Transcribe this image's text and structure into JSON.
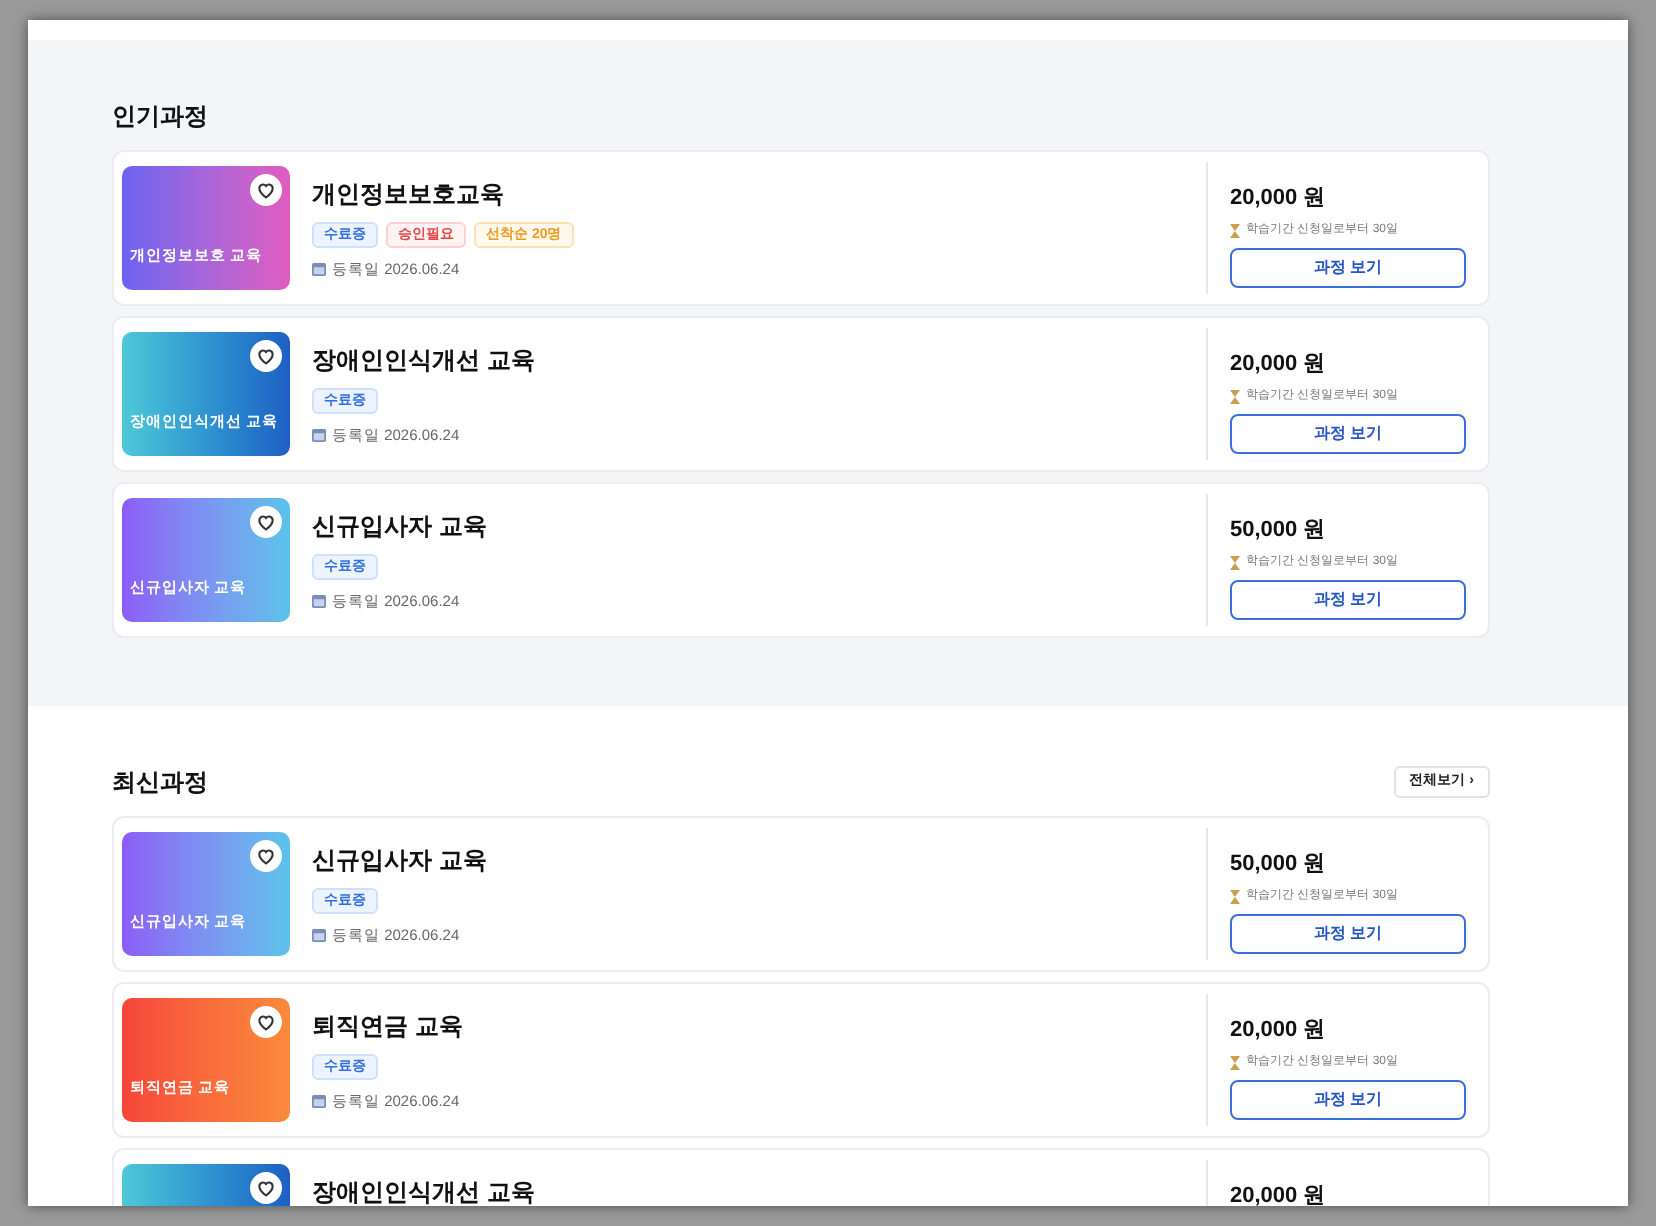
{
  "sections": [
    {
      "title": "인기과정",
      "courses": [
        {
          "thumb_label": "개인정보보호 교육",
          "kind": "purple",
          "title": "개인정보보호교육",
          "tags": [
            {
              "label": "수료증",
              "kind": "status"
            },
            {
              "label": "승인필요",
              "kind": "approval"
            },
            {
              "label": "선착순 20명",
              "kind": "limit"
            }
          ],
          "date": "등록일 2026.06.24",
          "price": "20,000 원",
          "period": "학습기간 신청일로부터 30일",
          "button": "과정 보기"
        },
        {
          "thumb_label": "장애인인식개선 교육",
          "kind": "cyan",
          "title": "장애인인식개선 교육",
          "tags": [
            {
              "label": "수료증",
              "kind": "status"
            }
          ],
          "date": "등록일 2026.06.24",
          "price": "20,000 원",
          "period": "학습기간 신청일로부터 30일",
          "button": "과정 보기"
        },
        {
          "thumb_label": "신규입사자 교육",
          "kind": "violet",
          "title": "신규입사자 교육",
          "tags": [
            {
              "label": "수료증",
              "kind": "status"
            }
          ],
          "date": "등록일 2026.06.24",
          "price": "50,000 원",
          "period": "학습기간 신청일로부터 30일",
          "button": "과정 보기"
        }
      ]
    },
    {
      "title": "최신과정",
      "more": "전체보기 ›",
      "courses": [
        {
          "thumb_label": "신규입사자 교육",
          "kind": "violet",
          "title": "신규입사자 교육",
          "tags": [
            {
              "label": "수료증",
              "kind": "status"
            }
          ],
          "date": "등록일 2026.06.24",
          "price": "50,000 원",
          "period": "학습기간 신청일로부터 30일",
          "button": "과정 보기"
        },
        {
          "thumb_label": "퇴직연금 교육",
          "kind": "red",
          "title": "퇴직연금 교육",
          "tags": [
            {
              "label": "수료증",
              "kind": "status"
            }
          ],
          "date": "등록일 2026.06.24",
          "price": "20,000 원",
          "period": "학습기간 신청일로부터 30일",
          "button": "과정 보기"
        },
        {
          "kind": "cyan",
          "title": "장애인인식개선 교육",
          "price": "20,000 원"
        }
      ]
    }
  ]
}
